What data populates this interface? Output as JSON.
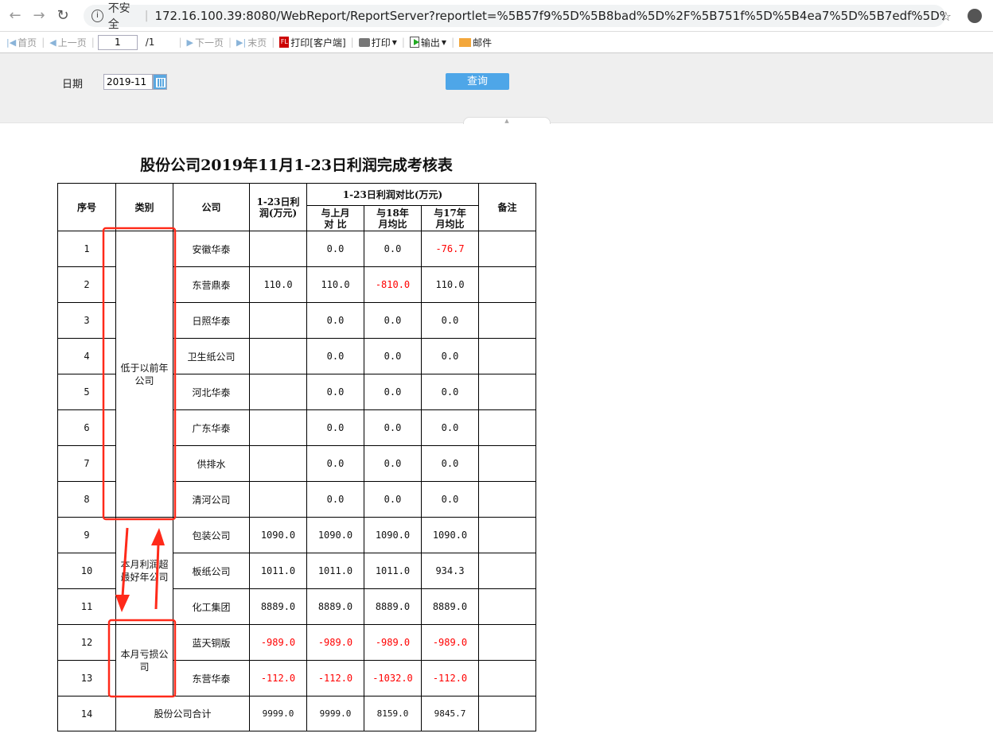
{
  "browser": {
    "security_label": "不安全",
    "url": "172.16.100.39:8080/WebReport/ReportServer?reportlet=%5B57f9%5D%5B8bad%5D%2F%5B751f%5D%5B4ea7%5D%5B7edf%5D%5B8ba1%5..."
  },
  "toolbar": {
    "first": "首页",
    "prev": "上一页",
    "page": "1",
    "total": "/1",
    "next": "下一页",
    "last": "末页",
    "print_client": "打印[客户端]",
    "print": "打印",
    "export": "输出",
    "mail": "邮件",
    "fl_badge": "FL"
  },
  "params": {
    "date_label": "日期",
    "date_value": "2019-11",
    "query": "查询"
  },
  "report": {
    "title": "股份公司2019年11月1-23日利润完成考核表",
    "headers": {
      "seq": "序号",
      "category": "类别",
      "company": "公司",
      "profit": "1-23日利润(万元)",
      "compare": "1-23日利润对比(万元)",
      "vs_last_month": "与上月对 比",
      "vs_18": "与18年月均比",
      "vs_17": "与17年月均比",
      "remark": "备注"
    },
    "categories": [
      "低于以前年公司",
      "本月利润超最好年公司",
      "本月亏损公司"
    ],
    "rows": [
      {
        "seq": "1",
        "company": "安徽华泰",
        "profit": "",
        "m": "0.0",
        "y18": "0.0",
        "y17": "-76.7"
      },
      {
        "seq": "2",
        "company": "东营鼎泰",
        "profit": "110.0",
        "m": "110.0",
        "y18": "-810.0",
        "y17": "110.0"
      },
      {
        "seq": "3",
        "company": "日照华泰",
        "profit": "",
        "m": "0.0",
        "y18": "0.0",
        "y17": "0.0"
      },
      {
        "seq": "4",
        "company": "卫生纸公司",
        "profit": "",
        "m": "0.0",
        "y18": "0.0",
        "y17": "0.0"
      },
      {
        "seq": "5",
        "company": "河北华泰",
        "profit": "",
        "m": "0.0",
        "y18": "0.0",
        "y17": "0.0"
      },
      {
        "seq": "6",
        "company": "广东华泰",
        "profit": "",
        "m": "0.0",
        "y18": "0.0",
        "y17": "0.0"
      },
      {
        "seq": "7",
        "company": "供排水",
        "profit": "",
        "m": "0.0",
        "y18": "0.0",
        "y17": "0.0"
      },
      {
        "seq": "8",
        "company": "清河公司",
        "profit": "",
        "m": "0.0",
        "y18": "0.0",
        "y17": "0.0"
      },
      {
        "seq": "9",
        "company": "包装公司",
        "profit": "1090.0",
        "m": "1090.0",
        "y18": "1090.0",
        "y17": "1090.0"
      },
      {
        "seq": "10",
        "company": "板纸公司",
        "profit": "1011.0",
        "m": "1011.0",
        "y18": "1011.0",
        "y17": "934.3"
      },
      {
        "seq": "11",
        "company": "化工集团",
        "profit": "8889.0",
        "m": "8889.0",
        "y18": "8889.0",
        "y17": "8889.0"
      },
      {
        "seq": "12",
        "company": "蓝天铜版",
        "profit": "-989.0",
        "m": "-989.0",
        "y18": "-989.0",
        "y17": "-989.0"
      },
      {
        "seq": "13",
        "company": "东营华泰",
        "profit": "-112.0",
        "m": "-112.0",
        "y18": "-1032.0",
        "y17": "-112.0"
      }
    ],
    "total": {
      "seq": "14",
      "label": "股份公司合计",
      "profit": "9999.0",
      "m": "9999.0",
      "y18": "8159.0",
      "y17": "9845.7"
    },
    "annotation_color": "#ff2a1a"
  }
}
